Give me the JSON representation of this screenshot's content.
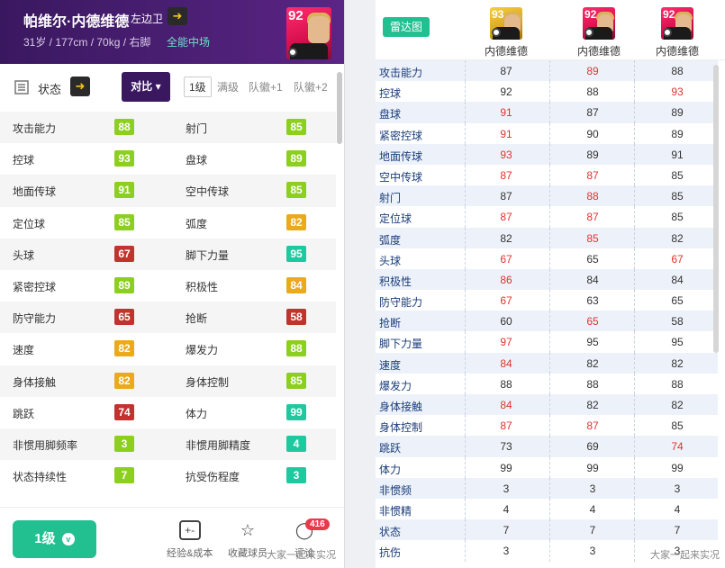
{
  "left_panel": {
    "player_name": "帕维尔·内德维德",
    "position": "左边卫",
    "info": "31岁 / 177cm / 70kg / 右脚",
    "play_style": "全能中场",
    "rating": "92",
    "status_label": "状态",
    "compare_label": "对比",
    "levels": [
      "1级",
      "满级",
      "队徽+1",
      "队徽+2"
    ],
    "stats": [
      {
        "a_label": "攻击能力",
        "a_val": "88",
        "a_color": "g",
        "b_label": "射门",
        "b_val": "85",
        "b_color": "g"
      },
      {
        "a_label": "控球",
        "a_val": "93",
        "a_color": "g",
        "b_label": "盘球",
        "b_val": "89",
        "b_color": "g"
      },
      {
        "a_label": "地面传球",
        "a_val": "91",
        "a_color": "g",
        "b_label": "空中传球",
        "b_val": "85",
        "b_color": "g"
      },
      {
        "a_label": "定位球",
        "a_val": "85",
        "a_color": "g",
        "b_label": "弧度",
        "b_val": "82",
        "b_color": "o"
      },
      {
        "a_label": "头球",
        "a_val": "67",
        "a_color": "r",
        "b_label": "脚下力量",
        "b_val": "95",
        "b_color": "t"
      },
      {
        "a_label": "紧密控球",
        "a_val": "89",
        "a_color": "g",
        "b_label": "积极性",
        "b_val": "84",
        "b_color": "o"
      },
      {
        "a_label": "防守能力",
        "a_val": "65",
        "a_color": "r",
        "b_label": "抢断",
        "b_val": "58",
        "b_color": "r"
      },
      {
        "a_label": "速度",
        "a_val": "82",
        "a_color": "o",
        "b_label": "爆发力",
        "b_val": "88",
        "b_color": "g"
      },
      {
        "a_label": "身体接触",
        "a_val": "82",
        "a_color": "o",
        "b_label": "身体控制",
        "b_val": "85",
        "b_color": "g"
      },
      {
        "a_label": "跳跃",
        "a_val": "74",
        "a_color": "r",
        "b_label": "体力",
        "b_val": "99",
        "b_color": "t"
      },
      {
        "a_label": "非惯用脚频率",
        "a_val": "3",
        "a_color": "g",
        "b_label": "非惯用脚精度",
        "b_val": "4",
        "b_color": "t"
      },
      {
        "a_label": "状态持续性",
        "a_val": "7",
        "a_color": "g",
        "b_label": "抗受伤程度",
        "b_val": "3",
        "b_color": "t"
      }
    ],
    "footer": {
      "level_button": "1级",
      "chevron_glyph": "v",
      "box_glyph": "+-",
      "star_glyph": "☆",
      "chat_glyph": "◯",
      "items": [
        "经验&成本",
        "收藏球员",
        "评论"
      ],
      "notif_count": "416"
    }
  },
  "right_panel": {
    "radar_label": "雷达图",
    "players": [
      {
        "name": "内德维德",
        "rating": "93",
        "card": "gold"
      },
      {
        "name": "内德维德",
        "rating": "92",
        "card": "pink"
      },
      {
        "name": "内德维德",
        "rating": "92",
        "card": "pink"
      }
    ],
    "rows": [
      {
        "name": "攻击能力",
        "vals": [
          "87",
          "89",
          "88"
        ],
        "red": [
          false,
          true,
          false
        ]
      },
      {
        "name": "控球",
        "vals": [
          "92",
          "88",
          "93"
        ],
        "red": [
          false,
          false,
          true
        ]
      },
      {
        "name": "盘球",
        "vals": [
          "91",
          "87",
          "89"
        ],
        "red": [
          true,
          false,
          false
        ]
      },
      {
        "name": "紧密控球",
        "vals": [
          "91",
          "90",
          "89"
        ],
        "red": [
          true,
          false,
          false
        ]
      },
      {
        "name": "地面传球",
        "vals": [
          "93",
          "89",
          "91"
        ],
        "red": [
          true,
          false,
          false
        ]
      },
      {
        "name": "空中传球",
        "vals": [
          "87",
          "87",
          "85"
        ],
        "red": [
          true,
          true,
          false
        ]
      },
      {
        "name": "射门",
        "vals": [
          "87",
          "88",
          "85"
        ],
        "red": [
          false,
          true,
          false
        ]
      },
      {
        "name": "定位球",
        "vals": [
          "87",
          "87",
          "85"
        ],
        "red": [
          true,
          true,
          false
        ]
      },
      {
        "name": "弧度",
        "vals": [
          "82",
          "85",
          "82"
        ],
        "red": [
          false,
          true,
          false
        ]
      },
      {
        "name": "头球",
        "vals": [
          "67",
          "65",
          "67"
        ],
        "red": [
          true,
          false,
          true
        ]
      },
      {
        "name": "积极性",
        "vals": [
          "86",
          "84",
          "84"
        ],
        "red": [
          true,
          false,
          false
        ]
      },
      {
        "name": "防守能力",
        "vals": [
          "67",
          "63",
          "65"
        ],
        "red": [
          true,
          false,
          false
        ]
      },
      {
        "name": "抢断",
        "vals": [
          "60",
          "65",
          "58"
        ],
        "red": [
          false,
          true,
          false
        ]
      },
      {
        "name": "脚下力量",
        "vals": [
          "97",
          "95",
          "95"
        ],
        "red": [
          true,
          false,
          false
        ]
      },
      {
        "name": "速度",
        "vals": [
          "84",
          "82",
          "82"
        ],
        "red": [
          true,
          false,
          false
        ]
      },
      {
        "name": "爆发力",
        "vals": [
          "88",
          "88",
          "88"
        ],
        "red": [
          false,
          false,
          false
        ]
      },
      {
        "name": "身体接触",
        "vals": [
          "84",
          "82",
          "82"
        ],
        "red": [
          true,
          false,
          false
        ]
      },
      {
        "name": "身体控制",
        "vals": [
          "87",
          "87",
          "85"
        ],
        "red": [
          true,
          true,
          false
        ]
      },
      {
        "name": "跳跃",
        "vals": [
          "73",
          "69",
          "74"
        ],
        "red": [
          false,
          false,
          true
        ]
      },
      {
        "name": "体力",
        "vals": [
          "99",
          "99",
          "99"
        ],
        "red": [
          false,
          false,
          false
        ]
      },
      {
        "name": "非惯频",
        "vals": [
          "3",
          "3",
          "3"
        ],
        "red": [
          false,
          false,
          false
        ]
      },
      {
        "name": "非惯精",
        "vals": [
          "4",
          "4",
          "4"
        ],
        "red": [
          false,
          false,
          false
        ]
      },
      {
        "name": "状态",
        "vals": [
          "7",
          "7",
          "7"
        ],
        "red": [
          false,
          false,
          false
        ]
      },
      {
        "name": "抗伤",
        "vals": [
          "3",
          "3",
          "3"
        ],
        "red": [
          false,
          false,
          false
        ]
      }
    ]
  },
  "watermark": "大家一起来实况"
}
